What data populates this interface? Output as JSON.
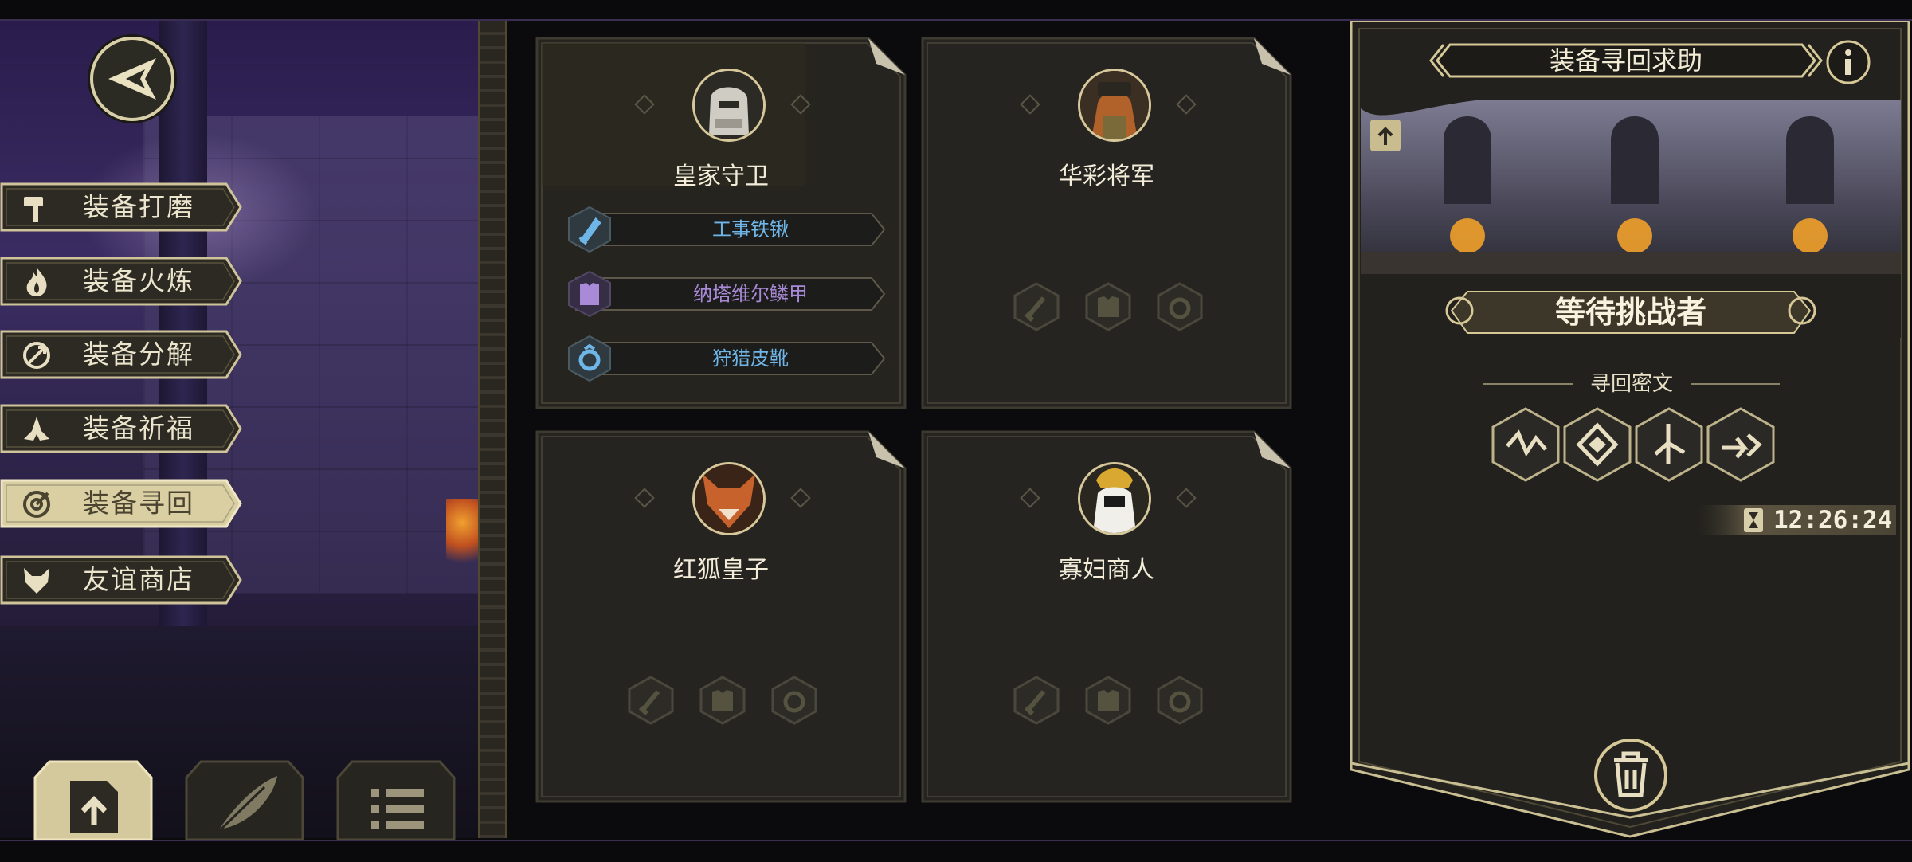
{
  "left_menu": {
    "items": [
      {
        "label": "装备打磨",
        "icon": "hammer-icon"
      },
      {
        "label": "装备火炼",
        "icon": "flame-icon"
      },
      {
        "label": "装备分解",
        "icon": "disassemble-icon"
      },
      {
        "label": "装备祈福",
        "icon": "praying-hands-icon"
      },
      {
        "label": "装备寻回",
        "icon": "target-icon",
        "active": true
      },
      {
        "label": "友谊商店",
        "icon": "fox-head-icon"
      }
    ],
    "bottom_buttons": [
      "upload-file-icon",
      "feather-icon",
      "list-icon"
    ]
  },
  "cards": [
    {
      "name": "皇家守卫",
      "slots": [
        {
          "label": "工事铁锹",
          "icon": "sword-icon",
          "color": "#6fb6e8"
        },
        {
          "label": "纳塔维尔鳞甲",
          "icon": "armor-icon",
          "color": "#a98ad8"
        },
        {
          "label": "狩猎皮靴",
          "icon": "ring-icon",
          "color": "#6fb6e8"
        }
      ]
    },
    {
      "name": "华彩将军",
      "slots": []
    },
    {
      "name": "红狐皇子",
      "slots": []
    },
    {
      "name": "寡妇商人",
      "slots": []
    }
  ],
  "right_panel": {
    "title": "装备寻回求助",
    "banner_text": "等待挑战者",
    "cipher_label": "寻回密文",
    "cipher_runes": [
      "rune-1-icon",
      "rune-2-icon",
      "rune-3-icon",
      "rune-4-icon"
    ],
    "timer": "12:26:24"
  },
  "colors": {
    "gold": "#d8cfa8",
    "panel": "#1f1e1a",
    "accent_blue": "#6fb6e8",
    "accent_purple": "#a98ad8"
  }
}
